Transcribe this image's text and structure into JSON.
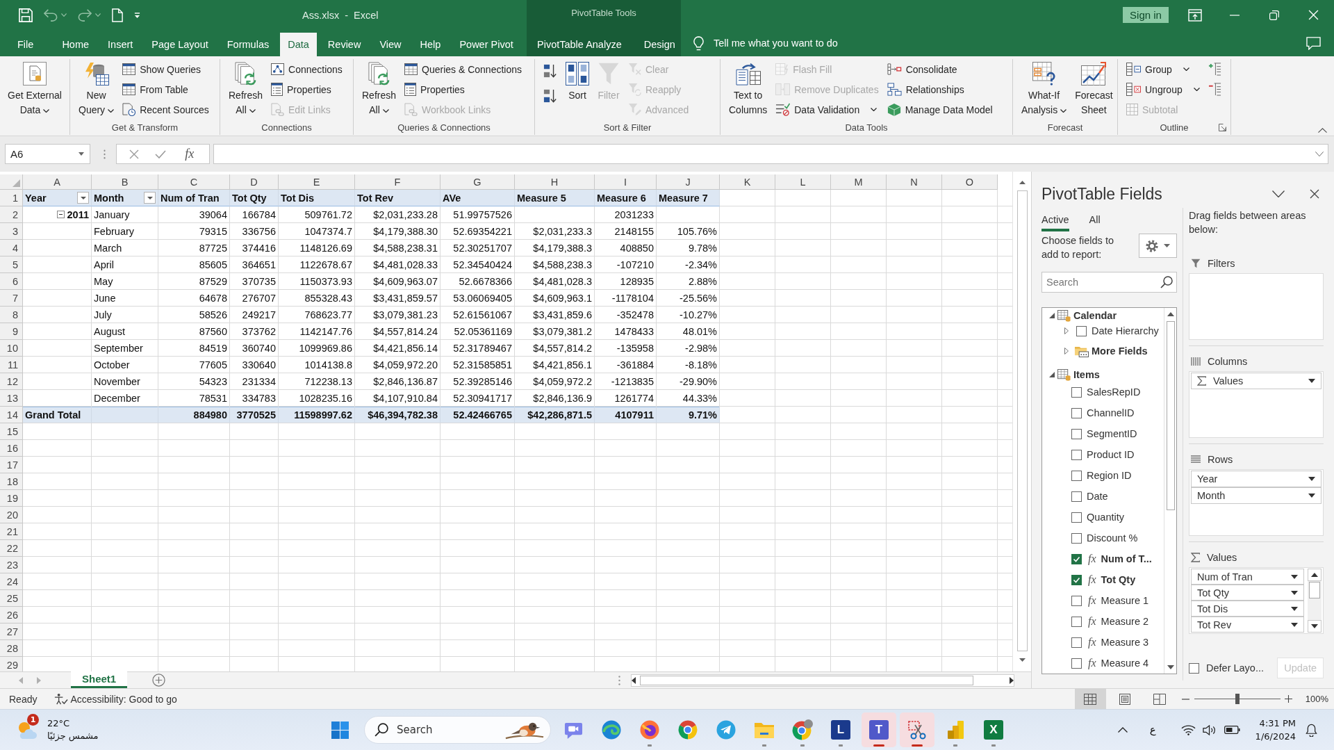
{
  "quick_access": [
    {
      "kind": "save",
      "disabled": false
    },
    {
      "kind": "undo",
      "disabled": true
    },
    {
      "kind": "redo",
      "disabled": true
    },
    {
      "kind": "new",
      "disabled": false
    },
    {
      "kind": "customize",
      "disabled": false
    }
  ],
  "title_bar": {
    "title": "Ass.xlsx - Excel",
    "contextual_title": "PivotTable Tools",
    "sign_in": "Sign in"
  },
  "ribbon_tabs": [
    {
      "label": "File",
      "selected": false
    },
    {
      "label": "Home",
      "selected": false
    },
    {
      "label": "Insert",
      "selected": false
    },
    {
      "label": "Page Layout",
      "selected": false
    },
    {
      "label": "Formulas",
      "selected": false
    },
    {
      "label": "Data",
      "selected": true
    },
    {
      "label": "Review",
      "selected": false
    },
    {
      "label": "View",
      "selected": false
    },
    {
      "label": "Help",
      "selected": false
    },
    {
      "label": "Power Pivot",
      "selected": false
    }
  ],
  "contextual_tabs": [
    {
      "label": "PivotTable Analyze",
      "selected": false
    },
    {
      "label": "Design",
      "selected": false
    }
  ],
  "tell_me": "Tell me what you want to do",
  "ribbon_groups": [
    {
      "launcher": false,
      "items": [
        {
          "kind": "large",
          "lines": [
            "Get External",
            "Data"
          ],
          "menu": true,
          "disabled": false
        }
      ]
    },
    {
      "label": "Get & Transform",
      "launcher": false,
      "items": [
        {
          "kind": "large",
          "lines": [
            "New",
            "Query"
          ],
          "menu": true,
          "disabled": false
        },
        {
          "kind": "small",
          "label": "Show Queries",
          "menu": false,
          "disabled": false
        },
        {
          "kind": "small",
          "label": "From Table",
          "menu": false,
          "disabled": false
        },
        {
          "kind": "small",
          "label": "Recent Sources",
          "menu": false,
          "disabled": false
        }
      ]
    },
    {
      "label": "Connections",
      "launcher": false,
      "items": [
        {
          "kind": "large",
          "lines": [
            "Refresh",
            "All"
          ],
          "menu": true,
          "disabled": false
        },
        {
          "kind": "small",
          "label": "Connections",
          "menu": false,
          "disabled": false
        },
        {
          "kind": "small",
          "label": "Properties",
          "menu": false,
          "disabled": false
        },
        {
          "kind": "small",
          "label": "Edit Links",
          "menu": false,
          "disabled": true
        }
      ]
    },
    {
      "label": "Queries & Connections",
      "launcher": false,
      "items": [
        {
          "kind": "large",
          "lines": [
            "Refresh",
            "All"
          ],
          "menu": true,
          "disabled": false
        },
        {
          "kind": "small",
          "label": "Queries & Connections",
          "menu": false,
          "disabled": false
        },
        {
          "kind": "small",
          "label": "Properties",
          "menu": false,
          "disabled": false
        },
        {
          "kind": "small",
          "label": "Workbook Links",
          "menu": false,
          "disabled": true
        }
      ]
    },
    {
      "label": "Sort & Filter",
      "launcher": false,
      "items": [
        {
          "kind": "icon",
          "menu": false,
          "disabled": false
        },
        {
          "kind": "icon",
          "menu": false,
          "disabled": false
        },
        {
          "kind": "large",
          "lines": [
            "Sort"
          ],
          "menu": false,
          "disabled": false
        },
        {
          "kind": "large",
          "lines": [
            "Filter"
          ],
          "menu": false,
          "disabled": true
        },
        {
          "kind": "small",
          "label": "Clear",
          "menu": false,
          "disabled": true
        },
        {
          "kind": "small",
          "label": "Reapply",
          "menu": false,
          "disabled": true
        },
        {
          "kind": "small",
          "label": "Advanced",
          "menu": false,
          "disabled": true
        }
      ]
    },
    {
      "label": "Data Tools",
      "launcher": false,
      "items": [
        {
          "kind": "large",
          "lines": [
            "Text to",
            "Columns"
          ],
          "menu": false,
          "disabled": false
        },
        {
          "kind": "small",
          "label": "Flash Fill",
          "menu": false,
          "disabled": true
        },
        {
          "kind": "small",
          "label": "Remove Duplicates",
          "menu": false,
          "disabled": true
        },
        {
          "kind": "small",
          "label": "Data Validation",
          "menu": true,
          "disabled": false
        },
        {
          "kind": "small",
          "label": "Consolidate",
          "menu": false,
          "disabled": false
        },
        {
          "kind": "small",
          "label": "Relationships",
          "menu": false,
          "disabled": false
        },
        {
          "kind": "small",
          "label": "Manage Data Model",
          "menu": false,
          "disabled": false
        }
      ]
    },
    {
      "label": "Forecast",
      "launcher": false,
      "items": [
        {
          "kind": "large",
          "lines": [
            "What-If",
            "Analysis"
          ],
          "menu": true,
          "disabled": false
        },
        {
          "kind": "large",
          "lines": [
            "Forecast",
            "Sheet"
          ],
          "menu": false,
          "disabled": false
        }
      ]
    },
    {
      "label": "Outline",
      "launcher": true,
      "items": [
        {
          "kind": "small",
          "label": "Group",
          "menu": true,
          "disabled": false
        },
        {
          "kind": "small",
          "label": "Ungroup",
          "menu": true,
          "disabled": false
        },
        {
          "kind": "small",
          "label": "Subtotal",
          "menu": false,
          "disabled": true
        },
        {
          "kind": "icon",
          "menu": false,
          "disabled": false
        },
        {
          "kind": "icon",
          "menu": false,
          "disabled": false
        }
      ]
    }
  ],
  "formula_bar": {
    "name_box": "A6",
    "function_symbol": "fx"
  },
  "sheet": {
    "column_letters": [
      "A",
      "B",
      "C",
      "D",
      "E",
      "F",
      "G",
      "H",
      "I",
      "J",
      "K",
      "L",
      "M",
      "N",
      "O"
    ],
    "row_numbers": [
      "1",
      "2",
      "3",
      "4",
      "5",
      "6",
      "7",
      "8",
      "9",
      "10",
      "11",
      "12",
      "13",
      "14",
      "15",
      "16",
      "17",
      "18",
      "19",
      "20",
      "21",
      "22",
      "23",
      "24",
      "25",
      "26",
      "27",
      "28",
      "29"
    ],
    "pivot": {
      "headers": [
        {
          "label": "Year",
          "filter": true
        },
        {
          "label": "Month",
          "filter": true
        },
        {
          "label": "Num of Tran",
          "filter": false
        },
        {
          "label": "Tot Qty",
          "filter": false
        },
        {
          "label": "Tot Dis",
          "filter": false
        },
        {
          "label": "Tot Rev",
          "filter": false
        },
        {
          "label": "AVe",
          "filter": false
        },
        {
          "label": "Measure 5",
          "filter": false
        },
        {
          "label": "Measure 6",
          "filter": false
        },
        {
          "label": "Measure 7",
          "filter": false
        }
      ],
      "years": [
        {
          "label": "2011",
          "expanded": true,
          "months": [
            {
              "label": "January",
              "cells": {
                "num_of_tran": "39064",
                "tot_qty": "166784",
                "tot_dis": "509761.72",
                "tot_rev": "$2,031,233.28",
                "ave": "51.99757526",
                "measure_6": "2031233"
              }
            },
            {
              "label": "February",
              "cells": {
                "num_of_tran": "79315",
                "tot_qty": "336756",
                "tot_dis": "1047374.7",
                "tot_rev": "$4,179,388.30",
                "ave": "52.69354221",
                "measure_5": "$2,031,233.3",
                "measure_6": "2148155",
                "measure_7": "105.76%"
              }
            },
            {
              "label": "March",
              "cells": {
                "num_of_tran": "87725",
                "tot_qty": "374416",
                "tot_dis": "1148126.69",
                "tot_rev": "$4,588,238.31",
                "ave": "52.30251707",
                "measure_5": "$4,179,388.3",
                "measure_6": "408850",
                "measure_7": "9.78%"
              }
            },
            {
              "label": "April",
              "cells": {
                "num_of_tran": "85605",
                "tot_qty": "364651",
                "tot_dis": "1122678.67",
                "tot_rev": "$4,481,028.33",
                "ave": "52.34540424",
                "measure_5": "$4,588,238.3",
                "measure_6": "-107210",
                "measure_7": "-2.34%"
              }
            },
            {
              "label": "May",
              "cells": {
                "num_of_tran": "87529",
                "tot_qty": "370735",
                "tot_dis": "1150373.93",
                "tot_rev": "$4,609,963.07",
                "ave": "52.6678366",
                "measure_5": "$4,481,028.3",
                "measure_6": "128935",
                "measure_7": "2.88%"
              }
            },
            {
              "label": "June",
              "cells": {
                "num_of_tran": "64678",
                "tot_qty": "276707",
                "tot_dis": "855328.43",
                "tot_rev": "$3,431,859.57",
                "ave": "53.06069405",
                "measure_5": "$4,609,963.1",
                "measure_6": "-1178104",
                "measure_7": "-25.56%"
              }
            },
            {
              "label": "July",
              "cells": {
                "num_of_tran": "58526",
                "tot_qty": "249217",
                "tot_dis": "768623.77",
                "tot_rev": "$3,079,381.23",
                "ave": "52.61561067",
                "measure_5": "$3,431,859.6",
                "measure_6": "-352478",
                "measure_7": "-10.27%"
              }
            },
            {
              "label": "August",
              "cells": {
                "num_of_tran": "87560",
                "tot_qty": "373762",
                "tot_dis": "1142147.76",
                "tot_rev": "$4,557,814.24",
                "ave": "52.05361169",
                "measure_5": "$3,079,381.2",
                "measure_6": "1478433",
                "measure_7": "48.01%"
              }
            },
            {
              "label": "September",
              "cells": {
                "num_of_tran": "84519",
                "tot_qty": "360740",
                "tot_dis": "1099969.86",
                "tot_rev": "$4,421,856.14",
                "ave": "52.31789467",
                "measure_5": "$4,557,814.2",
                "measure_6": "-135958",
                "measure_7": "-2.98%"
              }
            },
            {
              "label": "October",
              "cells": {
                "num_of_tran": "77605",
                "tot_qty": "330640",
                "tot_dis": "1014138.8",
                "tot_rev": "$4,059,972.20",
                "ave": "52.31585851",
                "measure_5": "$4,421,856.1",
                "measure_6": "-361884",
                "measure_7": "-8.18%"
              }
            },
            {
              "label": "November",
              "cells": {
                "num_of_tran": "54323",
                "tot_qty": "231334",
                "tot_dis": "712238.13",
                "tot_rev": "$2,846,136.87",
                "ave": "52.39285146",
                "measure_5": "$4,059,972.2",
                "measure_6": "-1213835",
                "measure_7": "-29.90%"
              }
            },
            {
              "label": "December",
              "cells": {
                "num_of_tran": "78531",
                "tot_qty": "334783",
                "tot_dis": "1028235.16",
                "tot_rev": "$4,107,910.84",
                "ave": "52.30941717",
                "measure_5": "$2,846,136.9",
                "measure_6": "1261774",
                "measure_7": "44.33%"
              }
            }
          ]
        }
      ],
      "grand_total": {
        "label": "Grand Total",
        "cells": {
          "num_of_tran": "884980",
          "tot_qty": "3770525",
          "tot_dis": "11598997.62",
          "tot_rev": "$46,394,782.38",
          "ave": "52.42466765",
          "measure_5": "$42,286,871.5",
          "measure_6": "4107911",
          "measure_7": "9.71%"
        }
      }
    },
    "tabs": [
      {
        "label": "Sheet1",
        "selected": true
      }
    ]
  },
  "pivot_fields": {
    "title": "PivotTable Fields",
    "tabs": [
      {
        "label": "Active",
        "selected": true
      },
      {
        "label": "All",
        "selected": false
      }
    ],
    "instructions": "Choose fields to add to report:",
    "search_placeholder": "Search",
    "tree": [
      {
        "kind": "table",
        "label": "Calendar",
        "expanded": true,
        "children": [
          {
            "kind": "hierarchy",
            "label": "Date Hierarchy",
            "expanded": false,
            "checked": false
          },
          {
            "kind": "folder",
            "label": "More Fields",
            "expanded": false
          }
        ]
      },
      {
        "kind": "table",
        "label": "Items",
        "expanded": true,
        "children": [
          {
            "kind": "field",
            "label": "SalesRepID",
            "checked": false
          },
          {
            "kind": "field",
            "label": "ChannelID",
            "checked": false
          },
          {
            "kind": "field",
            "label": "SegmentID",
            "checked": false
          },
          {
            "kind": "field",
            "label": "Product ID",
            "checked": false
          },
          {
            "kind": "field",
            "label": "Region ID",
            "checked": false
          },
          {
            "kind": "field",
            "label": "Date",
            "checked": false
          },
          {
            "kind": "field",
            "label": "Quantity",
            "checked": false
          },
          {
            "kind": "field",
            "label": "Discount %",
            "checked": false
          },
          {
            "kind": "measure",
            "symbol": "fx",
            "label": "Num of T...",
            "checked": true
          },
          {
            "kind": "measure",
            "symbol": "fx",
            "label": "Tot Qty",
            "checked": true
          },
          {
            "kind": "measure",
            "symbol": "fx",
            "label": "Measure 1",
            "checked": false
          },
          {
            "kind": "measure",
            "symbol": "fx",
            "label": "Measure 2",
            "checked": false
          },
          {
            "kind": "measure",
            "symbol": "fx",
            "label": "Measure 3",
            "checked": false
          },
          {
            "kind": "measure",
            "symbol": "fx",
            "label": "Measure 4",
            "checked": false
          }
        ]
      }
    ],
    "areas_hint": "Drag fields between areas below:",
    "areas": [
      {
        "kind": "filters",
        "label": "Filters"
      },
      {
        "kind": "columns",
        "label": "Columns",
        "items": [
          {
            "kind": "values",
            "label": "Values"
          }
        ]
      },
      {
        "kind": "rows",
        "label": "Rows",
        "items": [
          {
            "kind": "field",
            "label": "Year"
          },
          {
            "kind": "field",
            "label": "Month"
          }
        ]
      },
      {
        "kind": "values",
        "label": "Values",
        "items": [
          {
            "kind": "field",
            "label": "Num of Tran"
          },
          {
            "kind": "field",
            "label": "Tot Qty"
          },
          {
            "kind": "field",
            "label": "Tot Dis"
          },
          {
            "kind": "field",
            "label": "Tot Rev"
          }
        ]
      }
    ],
    "defer_layout": {
      "label": "Defer Layo...",
      "checked": false
    },
    "update_button": {
      "label": "Update",
      "disabled": true
    }
  },
  "status_bar": {
    "status": "Ready",
    "accessibility": "Accessibility: Good to go",
    "views": [
      {
        "kind": "normal",
        "selected": true
      },
      {
        "kind": "page_layout",
        "selected": false
      },
      {
        "kind": "page_break",
        "selected": false
      }
    ],
    "zoom": {
      "level": 0.5,
      "reading": "100%"
    }
  },
  "taskbar": {
    "weather": {
      "badge": "1",
      "temperature": "22°C",
      "condition": "مشمس جزئيًا"
    },
    "search_placeholder": "Search",
    "apps": [
      {
        "kind": "video_call",
        "running": false,
        "alert": false
      },
      {
        "kind": "browser_swirl",
        "running": false,
        "alert": false
      },
      {
        "kind": "browser_flame",
        "running": true,
        "alert": false
      },
      {
        "kind": "browser_segments",
        "running": false,
        "alert": false
      },
      {
        "kind": "messenger",
        "running": false,
        "alert": false
      },
      {
        "kind": "files",
        "running": true,
        "alert": false
      },
      {
        "kind": "browser_profile",
        "running": true,
        "alert": false
      },
      {
        "kind": "tile",
        "glyph": "L",
        "running": true,
        "alert": false
      },
      {
        "kind": "tile_people",
        "glyph": "T",
        "running": true,
        "alert": true
      },
      {
        "kind": "snipping",
        "running": true,
        "alert": true
      },
      {
        "kind": "report",
        "running": true,
        "alert": false
      },
      {
        "kind": "tile_grid",
        "glyph": "X",
        "running": true,
        "alert": false
      }
    ],
    "tray": {
      "language": "ع",
      "time": "4:31 PM",
      "date": "1/6/2024"
    }
  }
}
